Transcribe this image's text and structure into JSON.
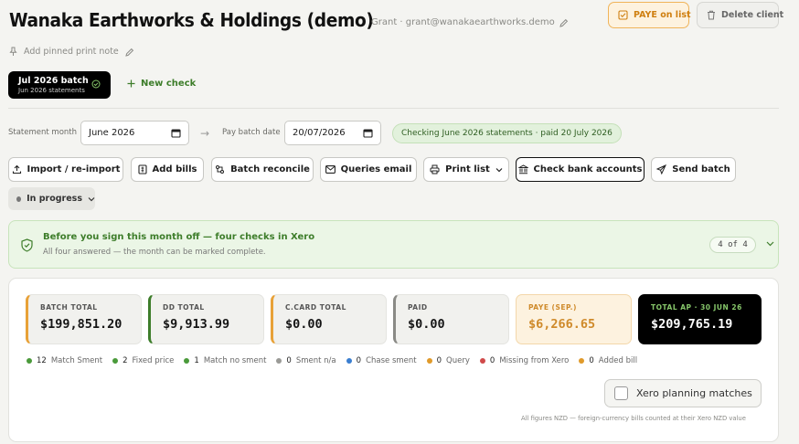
{
  "header": {
    "title": "Wanaka Earthworks & Holdings (demo)",
    "user": "Grant · grant@wanakaearthworks.demo",
    "paye_label": "PAYE on list",
    "delete_label": "Delete client",
    "pin_note": "Add pinned print note"
  },
  "batch_tab": {
    "title": "Jul 2026 batch",
    "subtitle": "Jun 2026 statements"
  },
  "new_check_label": "New check",
  "controls": {
    "statement_month_label": "Statement month",
    "statement_month_value": "June 2026",
    "pay_batch_label": "Pay batch date",
    "pay_batch_value": "20/07/2026",
    "status_pill": "Checking June 2026 statements · paid 20 July 2026"
  },
  "toolbar": {
    "import": "Import / re-import",
    "add_bills": "Add bills",
    "batch_reconcile": "Batch reconcile",
    "queries_email": "Queries email",
    "print_list": "Print list",
    "check_bank": "Check bank accounts",
    "send_batch": "Send batch"
  },
  "progress_label": "In progress",
  "banner": {
    "title": "Before you sign this month off — four checks in Xero",
    "subtitle": "All four answered — the month can be marked complete.",
    "counter": "4 of 4"
  },
  "cards": [
    {
      "label": "BATCH TOTAL",
      "value": "$199,851.20"
    },
    {
      "label": "DD TOTAL",
      "value": "$9,913.99"
    },
    {
      "label": "C.CARD TOTAL",
      "value": "$0.00"
    },
    {
      "label": "PAID",
      "value": "$0.00"
    },
    {
      "label": "PAYE (SEP.)",
      "value": "$6,266.65"
    },
    {
      "label": "TOTAL AP · 30 JUN 26",
      "value": "$209,765.19"
    }
  ],
  "legend": [
    {
      "count": "12",
      "label": "Match Sment",
      "color": "#4a9a3a"
    },
    {
      "count": "2",
      "label": "Fixed price",
      "color": "#4a9a3a"
    },
    {
      "count": "1",
      "label": "Match no sment",
      "color": "#4a9a3a"
    },
    {
      "count": "0",
      "label": "Sment n/a",
      "color": "#9a9a96"
    },
    {
      "count": "0",
      "label": "Chase sment",
      "color": "#3a7ed0"
    },
    {
      "count": "0",
      "label": "Query",
      "color": "#e09a2a"
    },
    {
      "count": "0",
      "label": "Missing from Xero",
      "color": "#d04a4a"
    },
    {
      "count": "0",
      "label": "Added bill",
      "color": "#e09a2a"
    }
  ],
  "xero_planning_label": "Xero planning matches",
  "footnote": "All figures NZD — foreign-currency bills counted at their Xero NZD value"
}
